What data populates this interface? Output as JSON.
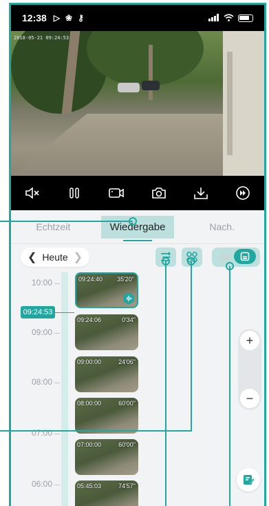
{
  "status_bar": {
    "time": "12:38"
  },
  "video": {
    "timestamp": "2018-05-21 09:24:53",
    "watermark": ""
  },
  "tabs": [
    {
      "label": "Echtzeit"
    },
    {
      "label": "Wiedergabe"
    },
    {
      "label": "Nach."
    }
  ],
  "date_selector": {
    "label": "Heute"
  },
  "timeline": {
    "current_time": "09:24:53",
    "hour_labels": [
      "10:00",
      "09:00",
      "08:00",
      "07:00",
      "06:00"
    ]
  },
  "clips": [
    {
      "start": "09:24:40",
      "duration": "35'20\""
    },
    {
      "start": "09:24:06",
      "duration": "0'34\""
    },
    {
      "start": "09:00:00",
      "duration": "24'06\""
    },
    {
      "start": "08:00:00",
      "duration": "60'00\""
    },
    {
      "start": "07:00:00",
      "duration": "60'00\""
    },
    {
      "start": "05:45:03",
      "duration": "74'57\""
    }
  ],
  "colors": {
    "accent": "#1fa7a0",
    "background": "#f2f3f5"
  },
  "icons": [
    "mute-icon",
    "pause-icon",
    "record-icon",
    "snapshot-icon",
    "download-icon",
    "speed-icon",
    "filter-icon",
    "grid-icon",
    "cloud-icon",
    "sd-card-icon",
    "zoom-in-icon",
    "zoom-out-icon",
    "note-icon"
  ]
}
